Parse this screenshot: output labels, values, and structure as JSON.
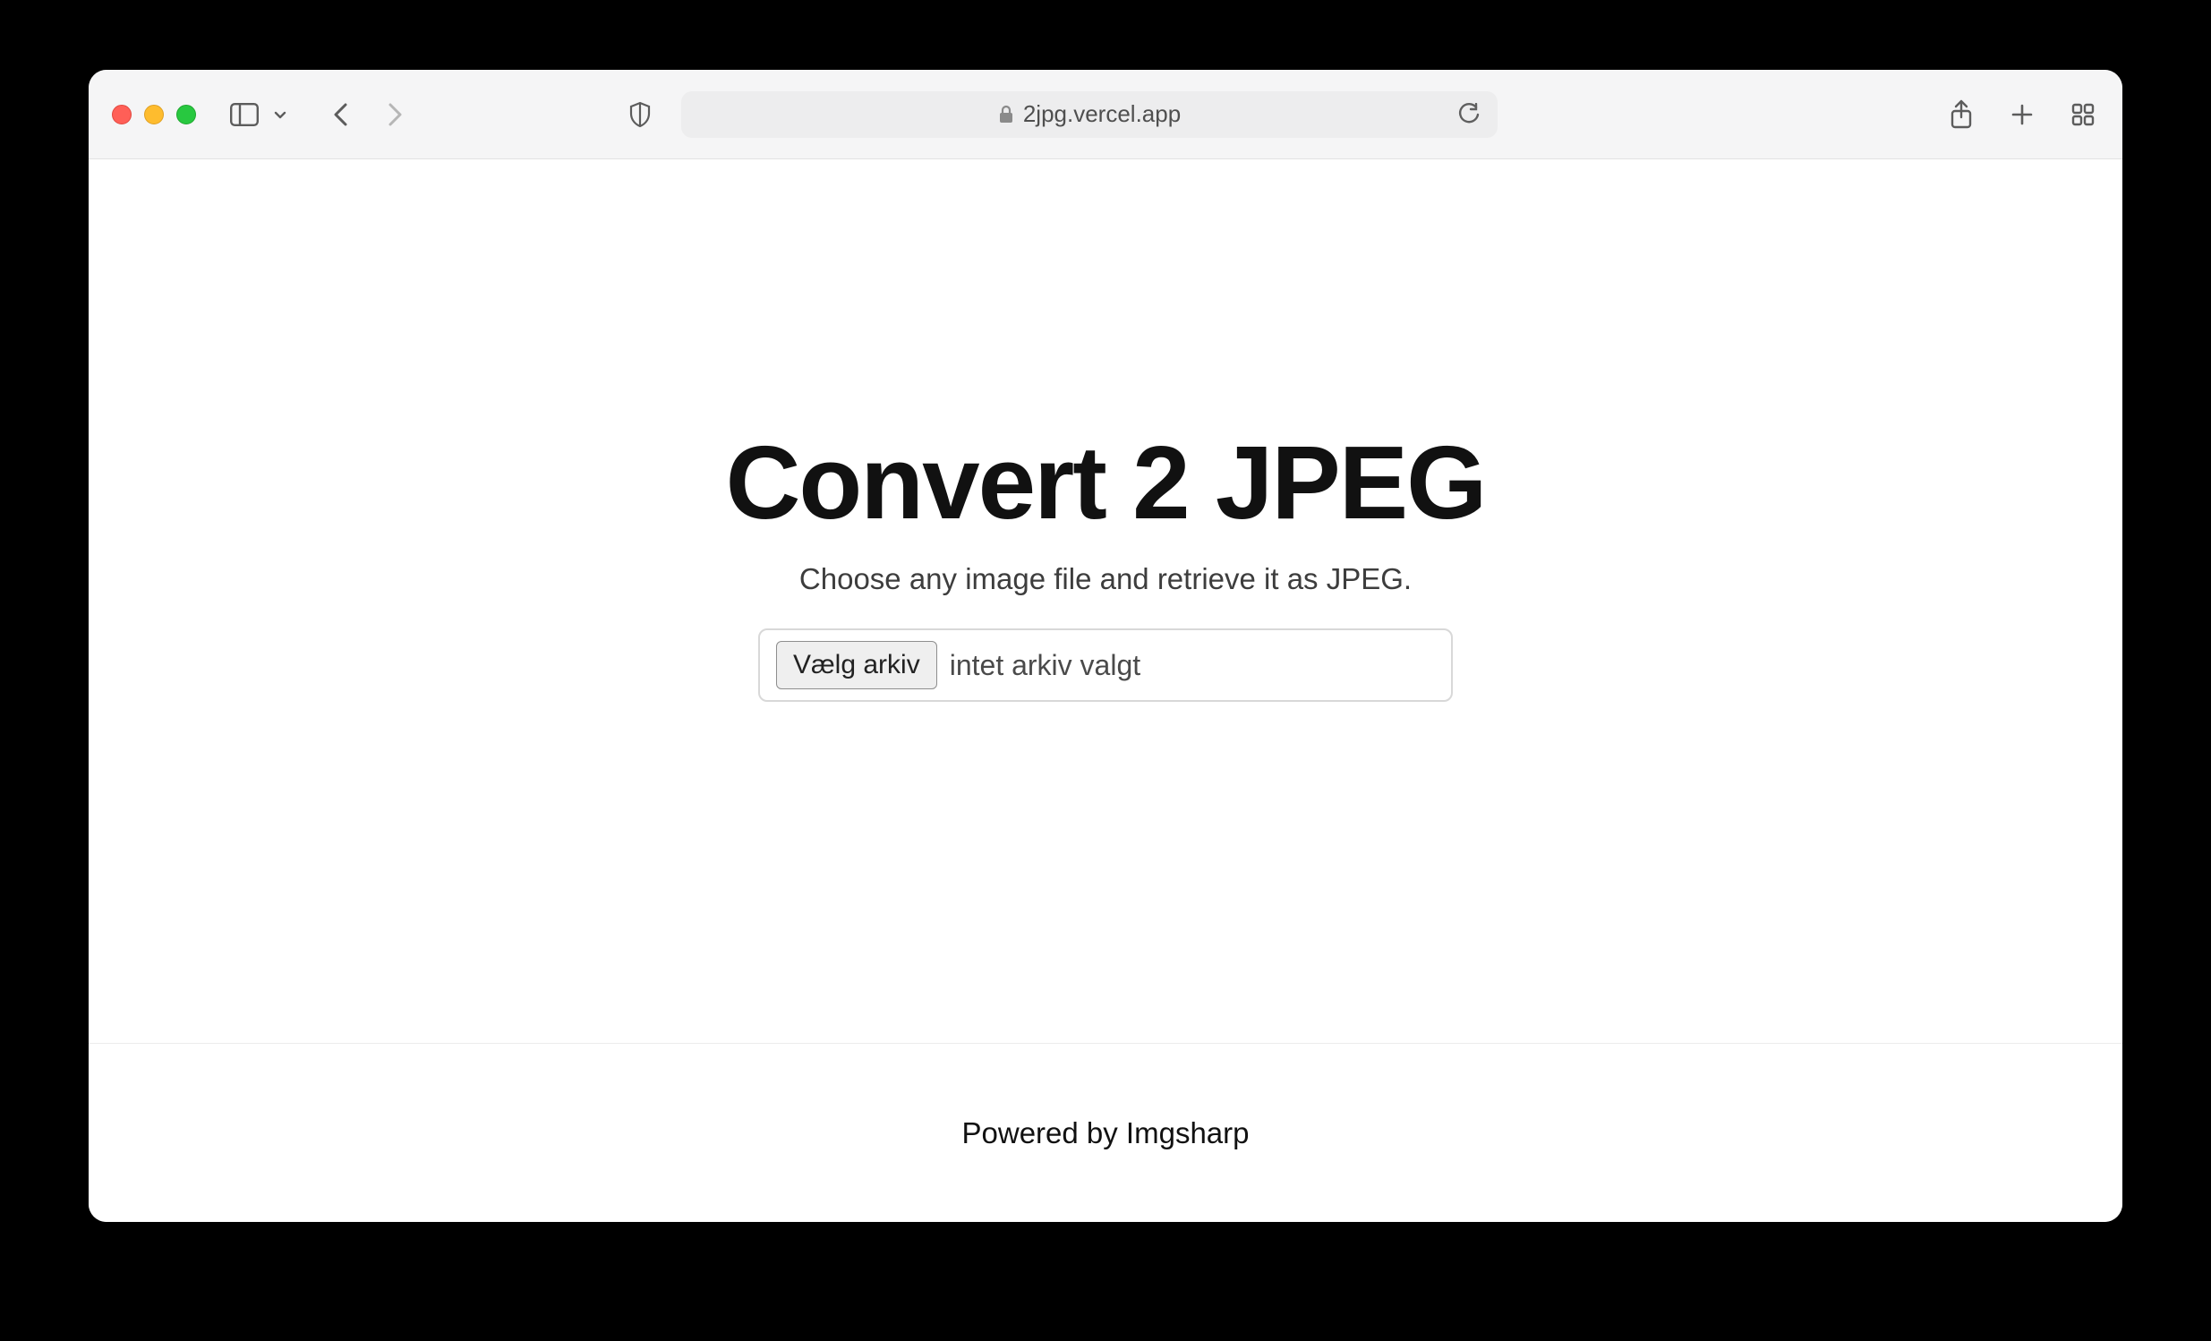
{
  "browser": {
    "url_display": "2jpg.vercel.app"
  },
  "page": {
    "title": "Convert 2 JPEG",
    "subtitle": "Choose any image file and retrieve it as JPEG.",
    "file_input": {
      "button_label": "Vælg arkiv",
      "status_text": "intet arkiv valgt"
    },
    "footer": "Powered by Imgsharp"
  }
}
